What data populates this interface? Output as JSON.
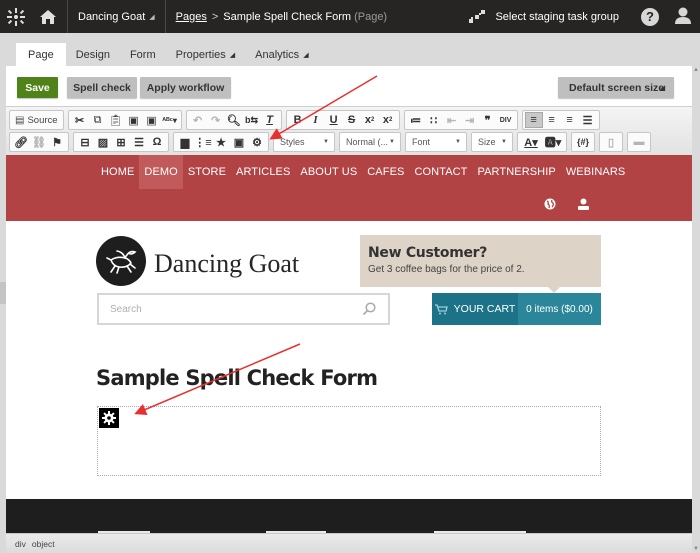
{
  "topbar": {
    "site_name": "Dancing Goat",
    "breadcrumb_link": "Pages",
    "breadcrumb_separator": ">",
    "breadcrumb_current": "Sample Spell Check Form",
    "breadcrumb_type": "(Page)",
    "staging_label": "Select staging task group",
    "help_label": "?"
  },
  "tabs": [
    {
      "label": "Page",
      "active": true
    },
    {
      "label": "Design"
    },
    {
      "label": "Form"
    },
    {
      "label": "Properties",
      "dropdown": true
    },
    {
      "label": "Analytics",
      "dropdown": true
    }
  ],
  "actions": {
    "save": "Save",
    "spell_check": "Spell check",
    "apply_workflow": "Apply workflow",
    "screen_size": "Default screen size"
  },
  "editor_toolbar": {
    "source_label": "Source",
    "styles": "Styles",
    "format": "Normal (...",
    "font": "Font",
    "size": "Size",
    "row1_icons": [
      "source-icon",
      "cut-icon",
      "copy-icon",
      "paste-icon",
      "paste-text-icon",
      "paste-word-icon",
      "spellcheck-icon",
      "undo-icon",
      "redo-icon",
      "find-icon",
      "replace-icon",
      "remove-format-icon",
      "bold-icon",
      "italic-icon",
      "underline-icon",
      "strikethrough-icon",
      "subscript-icon",
      "superscript-icon",
      "numbered-list-icon",
      "bulleted-list-icon",
      "decrease-indent-icon",
      "increase-indent-icon",
      "blockquote-icon",
      "div-icon",
      "align-left-icon",
      "align-center-icon",
      "align-right-icon",
      "justify-icon"
    ],
    "row2_icons": [
      "link-icon",
      "unlink-icon",
      "anchor-icon",
      "media-icon",
      "image-icon",
      "table-icon",
      "horizontal-rule-icon",
      "special-char-icon",
      "inline-widget-icon",
      "quick-form-icon",
      "poll-icon",
      "youtube-icon",
      "widget-gear-icon",
      "text-color-icon",
      "bg-color-icon",
      "macro-icon",
      "templates-icon",
      "form-field-icon"
    ]
  },
  "site_nav": {
    "items": [
      "HOME",
      "DEMO",
      "STORE",
      "ARTICLES",
      "ABOUT US",
      "CAFES",
      "CONTACT",
      "PARTNERSHIP",
      "WEBINARS"
    ],
    "active": "DEMO"
  },
  "header": {
    "brand": "Dancing Goat",
    "promo_title": "New Customer?",
    "promo_text": "Get 3 coffee bags for the price of 2.",
    "search_placeholder": "Search",
    "cart_label": "YOUR CART",
    "cart_summary": "0 items ($0.00)"
  },
  "page": {
    "title": "Sample Spell Check Form"
  },
  "statusbar": {
    "path": [
      "div",
      "object"
    ]
  },
  "colors": {
    "topbar_bg": "#262524",
    "save_green": "#4f8319",
    "nav_red": "#b24345",
    "cart_teal": "#1c7287",
    "promo_beige": "#ddd3c6",
    "annotation_arrow": "#e8312f"
  }
}
